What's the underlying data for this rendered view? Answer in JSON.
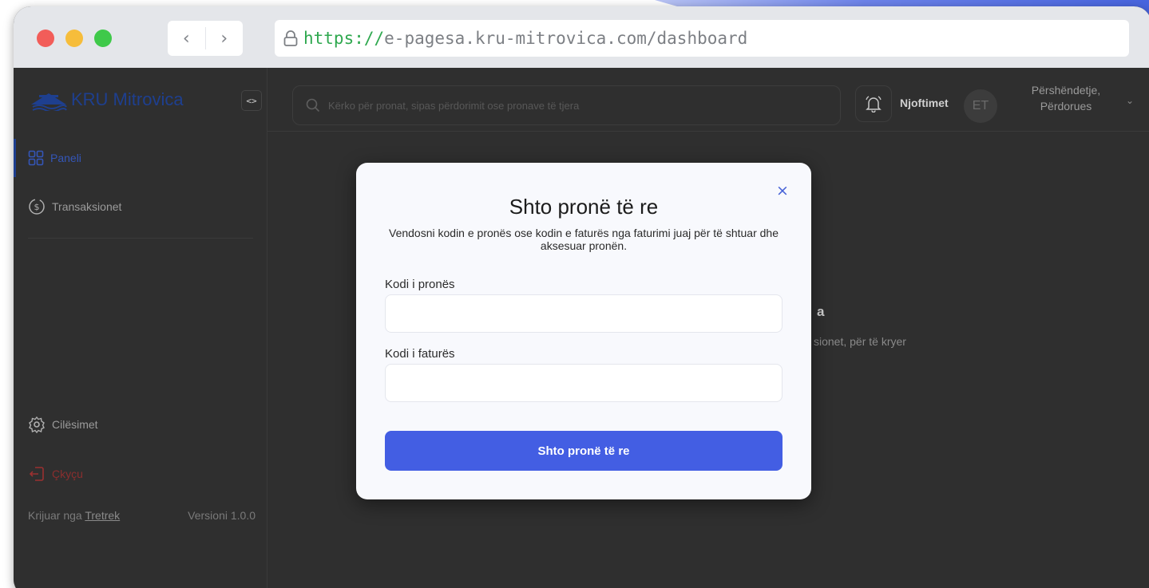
{
  "browser": {
    "back_glyph": "‹",
    "forward_glyph": "›",
    "url_scheme": "https://",
    "url_rest": "e-pagesa.kru-mitrovica.com/dashboard"
  },
  "sidebar": {
    "logo_text": "KRU Mitrovica",
    "collapse_glyph": "<>",
    "items": [
      {
        "label": "Paneli",
        "icon": "grid-icon"
      },
      {
        "label": "Transaksionet",
        "icon": "dollar-circle-icon"
      },
      {
        "label": "Cilësimet",
        "icon": "gear-icon"
      },
      {
        "label": "Çkyçu",
        "icon": "logout-icon"
      }
    ],
    "footer": {
      "created_by": "Krijuar nga",
      "author_link": "Tretrek",
      "version": "Versioni 1.0.0"
    }
  },
  "topbar": {
    "search_placeholder": "Kërko për pronat, sipas përdorimit ose pronave të tjera",
    "notifications_label": "Njoftimet",
    "avatar_initials": "ET",
    "greeting_line1": "Përshëndetje,",
    "greeting_line2": "Përdorues",
    "chevron_glyph": "⌄"
  },
  "background_fragments": {
    "heading_tail": "a",
    "text_tail": "sionet, për të kryer"
  },
  "modal": {
    "close_glyph": "×",
    "title": "Shto pronë të re",
    "description": "Vendosni kodin e pronës ose kodin e faturës nga faturimi juaj për të shtuar dhe aksesuar pronën.",
    "property_code_label": "Kodi i pronës",
    "property_code_value": "",
    "invoice_code_label": "Kodi i faturës",
    "invoice_code_value": "",
    "submit_label": "Shto pronë të re"
  },
  "colors": {
    "primary": "#435ee3",
    "logo_blue": "#1e3f8f",
    "overlay_bg": "#2f2f2f",
    "url_scheme": "#2fa84f"
  }
}
